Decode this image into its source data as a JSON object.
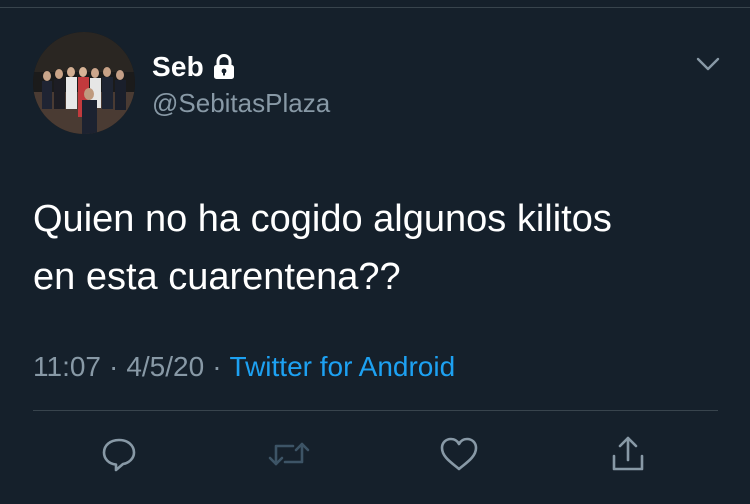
{
  "user": {
    "display_name": "Seb",
    "handle": "@SebitasPlaza",
    "protected_icon": "lock-icon"
  },
  "tweet": {
    "text_line1": "Quien no ha cogido algunos kilitos",
    "text_line2": "en esta cuarentena??",
    "time": "11:07",
    "date": "4/5/20",
    "source": "Twitter for Android",
    "separator": "·"
  },
  "actions": {
    "icons": [
      "reply-icon",
      "retweet-icon",
      "like-icon",
      "share-icon"
    ],
    "retweet_state": "disabled"
  },
  "colors": {
    "background": "#15202b",
    "primary_text": "#ffffff",
    "secondary_text": "#8899a6",
    "link": "#1da1f2",
    "divider": "#38444d",
    "retweet_disabled": "#3d5466"
  }
}
